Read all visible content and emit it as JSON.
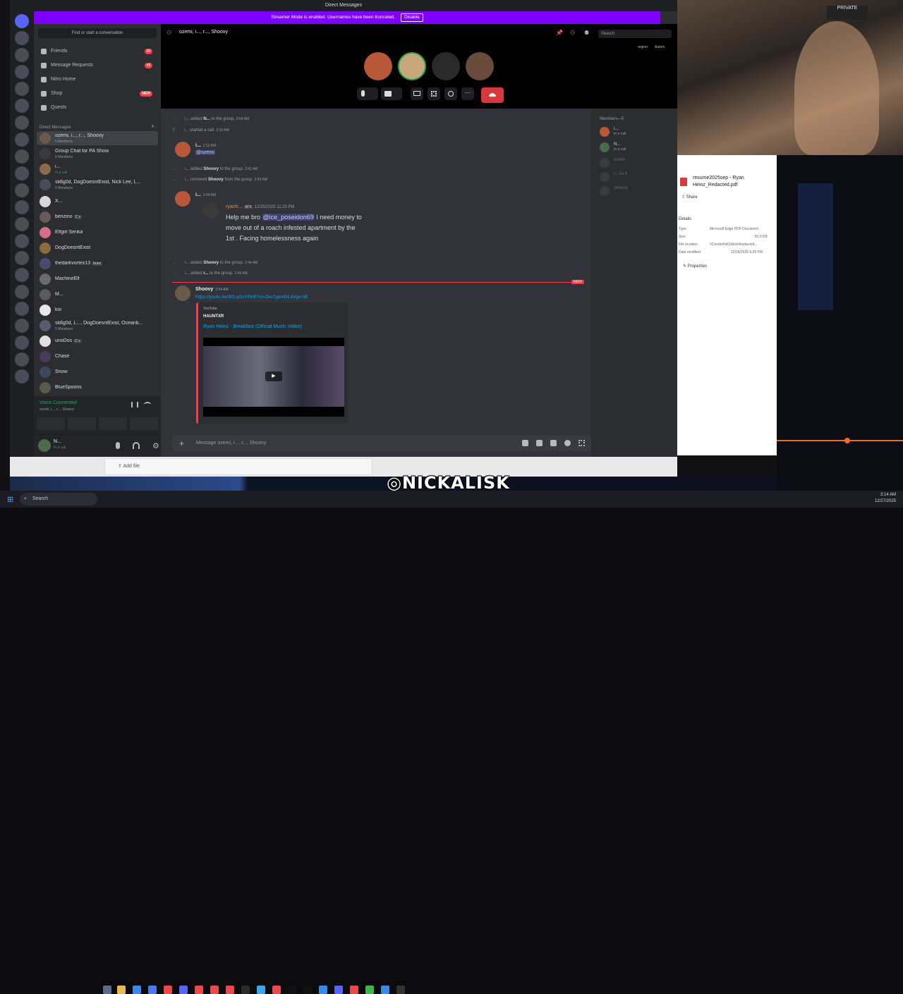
{
  "window": {
    "title": "Direct Messages"
  },
  "streamer": {
    "text": "Streamer Mode is enabled. Usernames have been truncated.",
    "disable": "Disable"
  },
  "sidebar": {
    "find": "Find or start a conversation",
    "nav": [
      {
        "label": "Friends",
        "count": "60"
      },
      {
        "label": "Message Requests",
        "count": "48"
      },
      {
        "label": "Nitro Home",
        "count": ""
      },
      {
        "label": "Shop",
        "badge": "NEW"
      },
      {
        "label": "Quests",
        "count": ""
      }
    ],
    "dm_header": "Direct Messages",
    "dms": [
      {
        "name": "ozemi, i..., r..., Shoovy",
        "sub": "5 Members"
      },
      {
        "name": "Group Chat for PA Show",
        "sub": "6 Members"
      },
      {
        "name": "i...",
        "sub": "In a call"
      },
      {
        "name": "sk8g0d, DogDoesntExist, Nick Lee, L...",
        "sub": "5 Members"
      },
      {
        "name": "X...",
        "sub": ""
      },
      {
        "name": "benzino",
        "tag": "C x",
        "sub": ""
      },
      {
        "name": "Elfgirl Serika",
        "tag": "",
        "sub": ""
      },
      {
        "name": "DogDoesntExist",
        "sub": ""
      },
      {
        "name": "thedarkvortex13",
        "tag": "bunz",
        "sub": ""
      },
      {
        "name": "MachineElf",
        "sub": ""
      },
      {
        "name": "M...",
        "sub": ""
      },
      {
        "name": "koi",
        "sub": ""
      },
      {
        "name": "sk8g0d, L..., DogDoesntExist, Oceanb...",
        "sub": "5 Members"
      },
      {
        "name": "unoDos",
        "tag": "C x",
        "sub": ""
      },
      {
        "name": "Chase",
        "sub": ""
      },
      {
        "name": "Snow",
        "sub": ""
      },
      {
        "name": "BlueSpoons",
        "sub": ""
      }
    ],
    "voice": {
      "title": "Voice Connected",
      "sub": "ozemi, i..., r..., Shoovy"
    },
    "user": {
      "name": "N...",
      "status": "In a call"
    }
  },
  "header": {
    "title": "ozemi, i..., r..., Shoovy",
    "search": "Search",
    "region": "region",
    "auto": "Autom"
  },
  "chat": {
    "sys1": {
      "who": "i...",
      "text": "added",
      "target": "N...",
      "rest": "to the group.",
      "time": "2:09 AM"
    },
    "sys2": {
      "who": "i...",
      "text": "started a call.",
      "time": "2:10 AM"
    },
    "msg1": {
      "name": "i...",
      "time": "2:12 AM",
      "mention": "@ozemi"
    },
    "sys3": {
      "who": "i...",
      "text": "added",
      "target": "Shoovy",
      "rest": "to the group.",
      "time": "2:42 AM"
    },
    "sys4": {
      "who": "i...",
      "text": "removed",
      "target": "Shoovy",
      "rest": "from the group.",
      "time": "2:43 AM"
    },
    "msg2": {
      "name": "i...",
      "time": "2:44 AM"
    },
    "quote": {
      "name": "ryanh...",
      "tag": "ATX",
      "time": "12/25/2025 11:25 PM",
      "line1": "Help me bro",
      "mention": "@ice_poseidon69",
      "line1b": "I need money to",
      "line2": "move out of a roach infested apartment by the",
      "line3": "1st . Facing homelessness again"
    },
    "sys5": {
      "who": "i...",
      "text": "added",
      "target": "Shoovy",
      "rest": "to the group.",
      "time": "2:44 AM"
    },
    "sys6": {
      "who": "i...",
      "text": "added",
      "target": "r...",
      "rest": "to the group.",
      "time": "2:49 AM"
    },
    "new": "NEW",
    "msg3": {
      "name": "Shoovy",
      "time": "3:04 AM",
      "link": "https://youtu.be/3tS-yGLFRhE?si=Zes7gemDLAVgv-hB"
    },
    "embed": {
      "provider": "YouTube",
      "author": "HAUNTXR",
      "title": "Ryan Heinz - Breakfast (Official Music Video)"
    },
    "input_placeholder": "Message ozemi, i..., r..., Shoovy"
  },
  "members": {
    "header": "Members—5",
    "list": [
      {
        "name": "i...",
        "status": "In a call"
      },
      {
        "name": "N...",
        "status": "In a call"
      },
      {
        "name": "ozemi",
        "status": ""
      },
      {
        "name": "r...",
        "status": "ATX"
      },
      {
        "name": "Shoovy",
        "status": ""
      }
    ]
  },
  "file": {
    "name": "resume2025sep - Ryan Heinz_Redacted.pdf",
    "share": "Share",
    "details": "Details",
    "rows": [
      {
        "k": "Type",
        "v": "Microsoft Edge PDF Document"
      },
      {
        "k": "Size",
        "v": "81.0 KB"
      },
      {
        "k": "File location",
        "v": "\\\\CondorNAS\\Nick\\Redacted..."
      },
      {
        "k": "Date modified",
        "v": "12/26/2025 6:25 PM"
      }
    ],
    "properties": "Properties"
  },
  "explorer": {
    "add_file": "Add file"
  },
  "overlay": {
    "handle": "NICKALISK"
  },
  "taskbar": {
    "search": "Search",
    "time": "3:14 AM",
    "date": "12/27/2025"
  },
  "colors": {
    "blurple": "#5865f2",
    "streamer": "#8000ff",
    "danger": "#da373c",
    "online": "#23a55a"
  }
}
